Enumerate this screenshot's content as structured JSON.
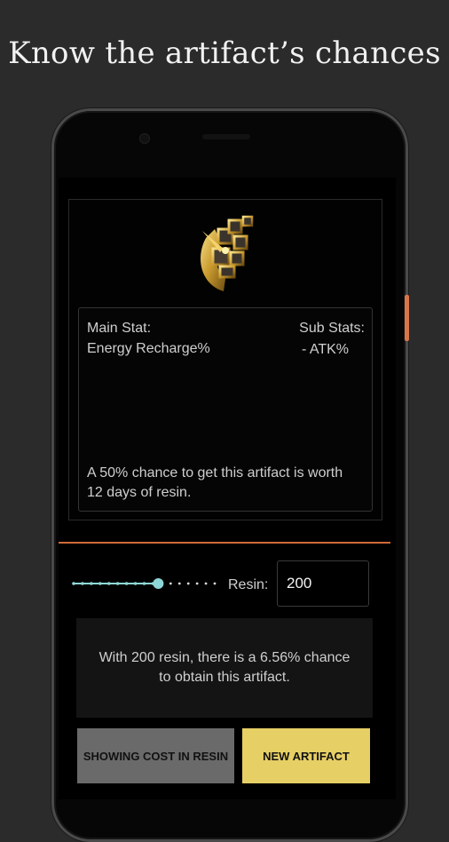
{
  "headline": "Know the artifact’s chances",
  "artifact": {
    "icon": "artifact-circlet-icon",
    "main_stat_label": "Main Stat:",
    "main_stat_value": "Energy Recharge%",
    "sub_stats_label": "Sub Stats:",
    "sub_stats_value": "- ATK%",
    "chance_text": "A 50% chance to get this artifact is worth 12 days of resin."
  },
  "controls": {
    "slider_position": 0.6,
    "resin_label": "Resin:",
    "resin_value": "200"
  },
  "result": {
    "text": "With 200 resin, there is a 6.56% chance to obtain this artifact."
  },
  "buttons": {
    "cost_mode": "SHOWING COST IN RESIN",
    "new_artifact": "NEW ARTIFACT"
  },
  "colors": {
    "accent": "#d06a38",
    "primary_button": "#e6cf65",
    "secondary_button": "#6a6a6a",
    "slider": "#8fd6d6"
  }
}
